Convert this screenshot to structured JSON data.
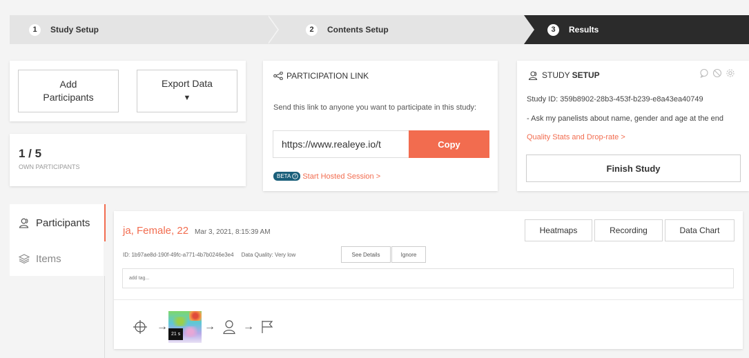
{
  "stepper": {
    "steps": [
      {
        "num": "1",
        "label": "Study Setup"
      },
      {
        "num": "2",
        "label": "Contents Setup"
      },
      {
        "num": "3",
        "label": "Results"
      }
    ]
  },
  "actions": {
    "add_participants": "Add Participants",
    "export_data": "Export Data",
    "export_caret": "▼"
  },
  "own_participants": {
    "count": "1 / 5",
    "label": "OWN PARTICIPANTS"
  },
  "participation": {
    "title": "PARTICIPATION LINK",
    "description": "Send this link to anyone you want to participate in this study:",
    "link": "https://www.realeye.io/t",
    "copy_label": "Copy",
    "beta_badge": "BETA",
    "hosted_session": "Start Hosted Session >"
  },
  "study_setup": {
    "title_prefix": "STUDY",
    "title_bold": "SETUP",
    "study_id": "Study ID: 359b8902-28b3-453f-b239-e8a43ea40749",
    "note": "- Ask my panelists about name, gender and age at the end",
    "quality_link": "Quality Stats and Drop-rate >",
    "finish_label": "Finish Study"
  },
  "sidebar": {
    "items": [
      {
        "label": "Participants"
      },
      {
        "label": "Items"
      }
    ]
  },
  "participant": {
    "name": "ja, Female, 22",
    "timestamp": "Mar 3, 2021, 8:15:39 AM",
    "id_text": "ID: 1b97ae8d-190f-49fc-a771-4b7b0246e3e4",
    "quality_text": "Data Quality: Very low",
    "see_details": "See Details",
    "ignore": "Ignore",
    "heatmaps": "Heatmaps",
    "recording": "Recording",
    "data_chart": "Data Chart",
    "tag_placeholder": "add tag...",
    "thumb_duration": "21 s"
  },
  "colors": {
    "accent": "#f26c4f",
    "dark": "#2b2b2b",
    "beta": "#1a5f7a"
  }
}
